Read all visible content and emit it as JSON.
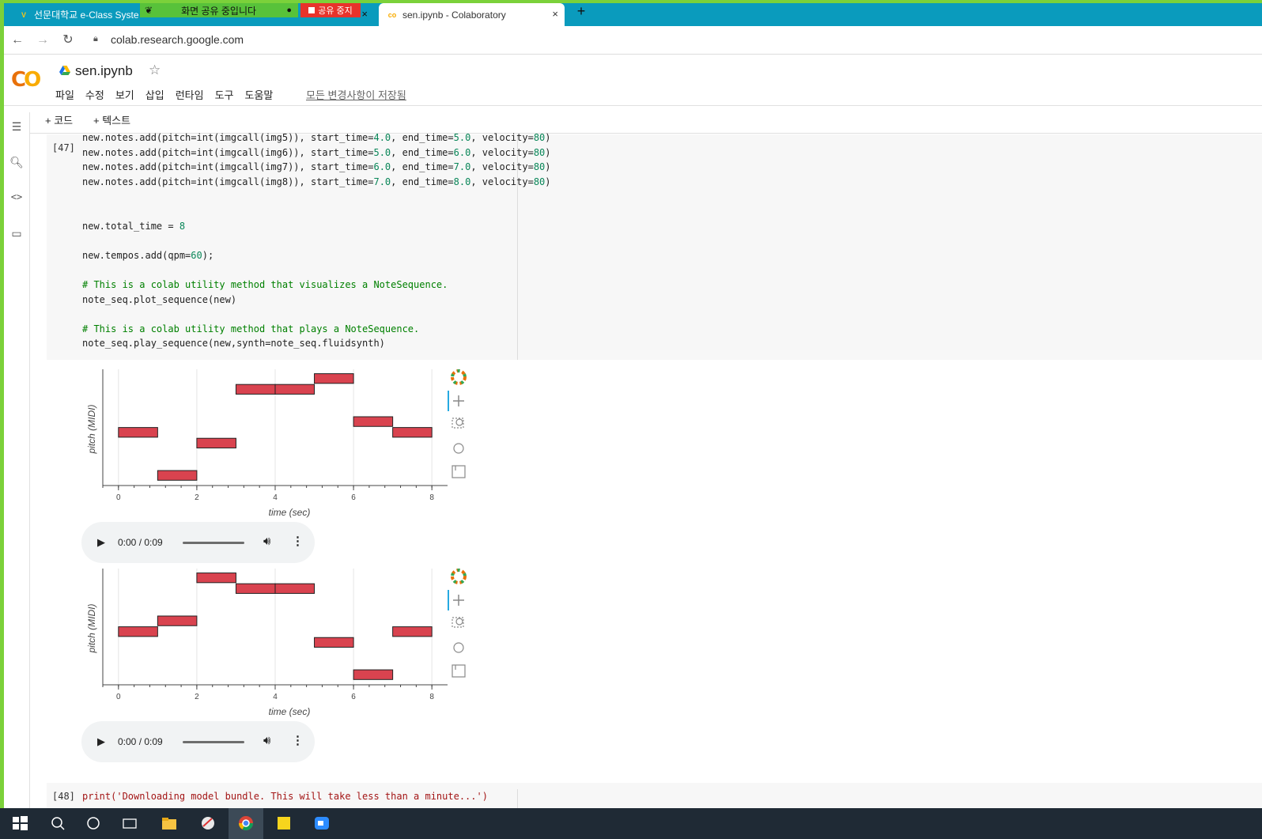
{
  "browser": {
    "tabs": [
      {
        "label": "선문대학교 e-Class Syste",
        "active": false
      },
      {
        "label": "sen.ipynb - Colaboratory",
        "active": true
      }
    ],
    "share_banner": "화면 공유 중입니다",
    "share_stop": "공유 중지",
    "url": "colab.research.google.com",
    "new_tab": "+",
    "close": "×"
  },
  "colab": {
    "logo_co": "CO",
    "notebook_title": "sen.ipynb",
    "menus": [
      "파일",
      "수정",
      "보기",
      "삽입",
      "런타임",
      "도구",
      "도움말"
    ],
    "saved_status": "모든 변경사항이 저장됨",
    "toolbar": {
      "add_code": "+ 코드",
      "add_text": "+ 텍스트"
    }
  },
  "cell47": {
    "number": "[47]",
    "lines": [
      [
        [
          "t",
          "new.notes.add(pitch=int(imgcall(img5)), start_time="
        ],
        [
          "n",
          "4.0"
        ],
        [
          "t",
          ", end_time="
        ],
        [
          "n",
          "5.0"
        ],
        [
          "t",
          ", velocity="
        ],
        [
          "n",
          "80"
        ],
        [
          "t",
          ")"
        ]
      ],
      [
        [
          "t",
          "new.notes.add(pitch=int(imgcall(img6)), start_time="
        ],
        [
          "n",
          "5.0"
        ],
        [
          "t",
          ", end_time="
        ],
        [
          "n",
          "6.0"
        ],
        [
          "t",
          ", velocity="
        ],
        [
          "n",
          "80"
        ],
        [
          "t",
          ")"
        ]
      ],
      [
        [
          "t",
          "new.notes.add(pitch=int(imgcall(img7)), start_time="
        ],
        [
          "n",
          "6.0"
        ],
        [
          "t",
          ", end_time="
        ],
        [
          "n",
          "7.0"
        ],
        [
          "t",
          ", velocity="
        ],
        [
          "n",
          "80"
        ],
        [
          "t",
          ")"
        ]
      ],
      [
        [
          "t",
          "new.notes.add(pitch=int(imgcall(img8)), start_time="
        ],
        [
          "n",
          "7.0"
        ],
        [
          "t",
          ", end_time="
        ],
        [
          "n",
          "8.0"
        ],
        [
          "t",
          ", velocity="
        ],
        [
          "n",
          "80"
        ],
        [
          "t",
          ")"
        ]
      ],
      [],
      [],
      [
        [
          "t",
          "new.total_time = "
        ],
        [
          "n",
          "8"
        ]
      ],
      [],
      [
        [
          "t",
          "new.tempos.add(qpm="
        ],
        [
          "n",
          "60"
        ],
        [
          "t",
          ");"
        ]
      ],
      [],
      [
        [
          "c",
          "# This is a colab utility method that visualizes a NoteSequence."
        ]
      ],
      [
        [
          "t",
          "note_seq.plot_sequence(new)"
        ]
      ],
      [],
      [
        [
          "c",
          "# This is a colab utility method that plays a NoteSequence."
        ]
      ],
      [
        [
          "t",
          "note_seq.play_sequence(new,synth=note_seq.fluidsynth)"
        ]
      ]
    ]
  },
  "chart_data": [
    {
      "type": "bar",
      "xlabel": "time (sec)",
      "ylabel": "pitch (MIDI)",
      "xticks": [
        0,
        2,
        4,
        6,
        8
      ],
      "xlim": [
        -0.4,
        8.4
      ],
      "pitch_levels": 10,
      "color": "#d9434f",
      "notes": [
        {
          "start": 0,
          "end": 1,
          "pitch": 4
        },
        {
          "start": 1,
          "end": 2,
          "pitch": 0
        },
        {
          "start": 2,
          "end": 3,
          "pitch": 3
        },
        {
          "start": 3,
          "end": 4,
          "pitch": 8
        },
        {
          "start": 4,
          "end": 5,
          "pitch": 8
        },
        {
          "start": 5,
          "end": 6,
          "pitch": 9
        },
        {
          "start": 6,
          "end": 7,
          "pitch": 5
        },
        {
          "start": 7,
          "end": 8,
          "pitch": 4
        }
      ]
    },
    {
      "type": "bar",
      "xlabel": "time (sec)",
      "ylabel": "pitch (MIDI)",
      "xticks": [
        0,
        2,
        4,
        6,
        8
      ],
      "xlim": [
        -0.4,
        8.4
      ],
      "pitch_levels": 10,
      "color": "#d9434f",
      "notes": [
        {
          "start": 0,
          "end": 1,
          "pitch": 4
        },
        {
          "start": 1,
          "end": 2,
          "pitch": 5
        },
        {
          "start": 2,
          "end": 3,
          "pitch": 9
        },
        {
          "start": 3,
          "end": 4,
          "pitch": 8
        },
        {
          "start": 4,
          "end": 5,
          "pitch": 8
        },
        {
          "start": 5,
          "end": 6,
          "pitch": 3
        },
        {
          "start": 6,
          "end": 7,
          "pitch": 0
        },
        {
          "start": 7,
          "end": 8,
          "pitch": 4
        }
      ]
    }
  ],
  "audio": {
    "time": "0:00 / 0:09"
  },
  "cell48": {
    "number": "[48]",
    "code": "print('Downloading model bundle. This will take less than a minute...')"
  }
}
